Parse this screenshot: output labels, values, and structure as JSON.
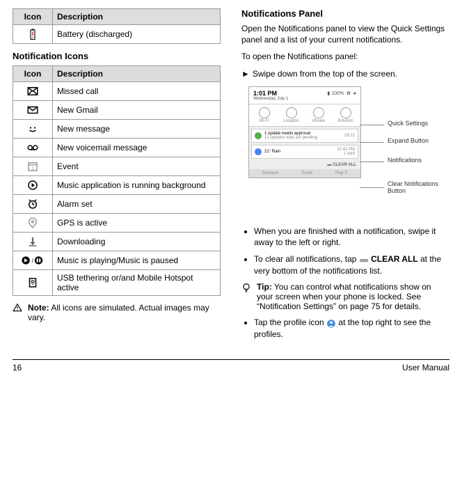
{
  "page_number": "16",
  "footer_right": "User Manual",
  "left": {
    "battery_table": {
      "header_icon": "Icon",
      "header_desc": "Description",
      "row_desc": "Battery (discharged)"
    },
    "notif_heading": "Notification Icons",
    "notif_table": {
      "header_icon": "Icon",
      "header_desc": "Description",
      "rows": {
        "0": "Missed call",
        "1": "New Gmail",
        "2": "New message",
        "3": "New voicemail message",
        "4": "Event",
        "5": "Music application is running background",
        "6": "Alarm set",
        "7": "GPS is active",
        "8": "Downloading",
        "9": "Music is playing/Music is paused",
        "10": "USB tethering or/and Mobile Hotspot active"
      }
    },
    "note_label": "Note:",
    "note_text": " All icons are simulated. Actual images may vary."
  },
  "right": {
    "heading": "Notifications Panel",
    "para1": "Open the Notifications panel to view the Quick Settings panel and a list of your current notifications.",
    "para2": "To open the Notifications panel:",
    "step1": "Swipe down from the top of the screen.",
    "bullet1": "When you are finished with a notification, swipe it away to the left or right.",
    "bullet2a": "To clear all notifications, tap ",
    "bullet2b": " CLEAR ALL",
    "bullet2c": " at the very bottom of the notifications list.",
    "tip_label": "Tip:",
    "tip_text": " You can control what notifications show on your screen when your phone is locked. See “Notification Settings” on page 75 for details.",
    "bullet3a": "Tap the profile icon ",
    "bullet3b": " at the top right to see the profiles.",
    "figure": {
      "time": "1:01 PM",
      "date": "Wednesday, July 1",
      "batt": "100%",
      "qs": {
        "0": "Wi-Fi",
        "1": "Location",
        "2": "Vibrate",
        "3": "Rotation"
      },
      "notif_update_title": "1 update needs approval",
      "notif_update_sub": "13 updates total are pending",
      "notif_update_time": "18:12",
      "notif_weather_title": "21° Rain",
      "notif_weather_time": "12:41 PM",
      "notif_weather_sub": "1 card",
      "clear_all": "CLEAR ALL",
      "bottom": {
        "0": "Contacts",
        "1": "Email",
        "2": "Play S"
      },
      "callout_qs": "Quick Settings",
      "callout_expand": "Expand Button",
      "callout_notif": "Notifications",
      "callout_clear": "Clear Notifications Button"
    }
  }
}
